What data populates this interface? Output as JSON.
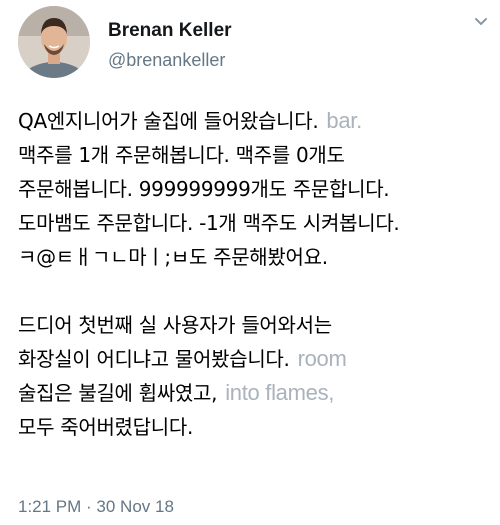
{
  "author": {
    "name": "Brenan Keller",
    "handle": "@brenankeller",
    "avatar_icon": "profile-photo"
  },
  "tweet": {
    "lines": [
      {
        "text": "QA엔지니어가 술집에 들어왔습니다.",
        "ghost": "bar."
      },
      {
        "text": "맥주를 1개 주문해봅니다. 맥주를 0개도",
        "ghost": ""
      },
      {
        "text": "주문해봅니다. 999999999개도 주문합니다.",
        "ghost": ""
      },
      {
        "text": "도마뱀도 주문합니다. -1개 맥주도 시켜봅니다.",
        "ghost": ""
      },
      {
        "text": "ㅋ@ㅌㅐㄱㄴ마ㅣ;ㅂ도 주문해봤어요.",
        "ghost": ""
      },
      {
        "text": "",
        "ghost": ""
      },
      {
        "text": "드디어 첫번째 실 사용자가 들어와서는",
        "ghost": ""
      },
      {
        "text": "화장실이 어디냐고 물어봤습니다.",
        "ghost": "room"
      },
      {
        "text": "술집은 불길에 휩싸였고,",
        "ghost": "into flames,"
      },
      {
        "text": "모두 죽어버렸답니다.",
        "ghost": ""
      }
    ]
  },
  "timestamp": "1:21 PM · 30 Nov 18",
  "colors": {
    "name": "#14171a",
    "secondary": "#657786",
    "ghost_text": "#aab2bb"
  }
}
